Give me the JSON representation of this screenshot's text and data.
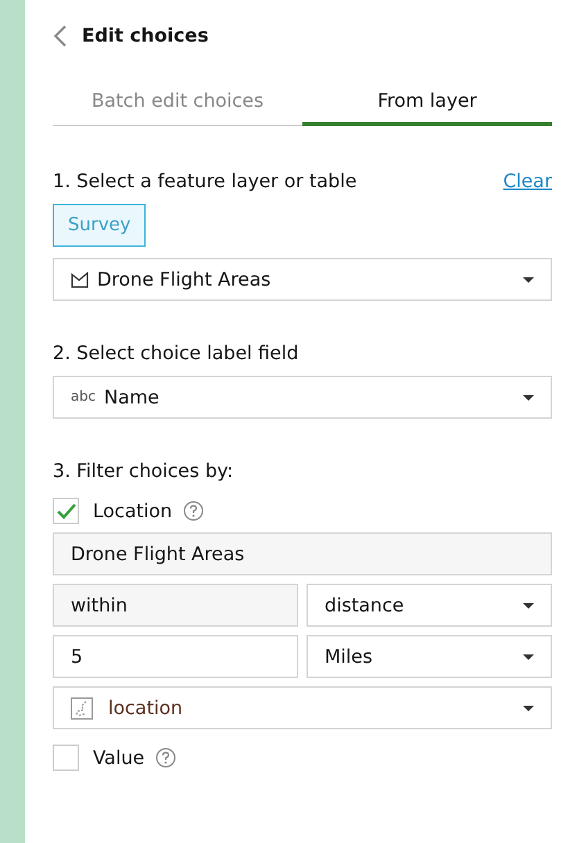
{
  "header": {
    "title": "Edit choices"
  },
  "tabs": [
    {
      "label": "Batch edit choices",
      "selected": false
    },
    {
      "label": "From layer",
      "selected": true
    }
  ],
  "layer_section": {
    "label": "1. Select a feature layer or table",
    "clear_link": "Clear",
    "source": {
      "label": "Survey",
      "selected": true
    },
    "layer_select": {
      "value": "Drone Flight Areas"
    }
  },
  "label_section": {
    "label": "2. Select choice label field",
    "field_select": {
      "type_label": "abc",
      "value": "Name"
    }
  },
  "filter_section": {
    "label": "3. Filter choices by:",
    "filters": [
      {
        "label": "Location",
        "checked": true,
        "rows": [
          [
            {
              "kind": "readonly",
              "value": "Drone Flight Areas"
            }
          ],
          [
            {
              "kind": "readonly",
              "value": "within"
            },
            {
              "kind": "select",
              "value": "distance"
            }
          ],
          [
            {
              "kind": "input",
              "value": "5"
            },
            {
              "kind": "select",
              "value": "Miles"
            }
          ],
          [
            {
              "kind": "geometry_select",
              "value": "location"
            }
          ]
        ]
      },
      {
        "label": "Value",
        "checked": false
      }
    ]
  }
}
